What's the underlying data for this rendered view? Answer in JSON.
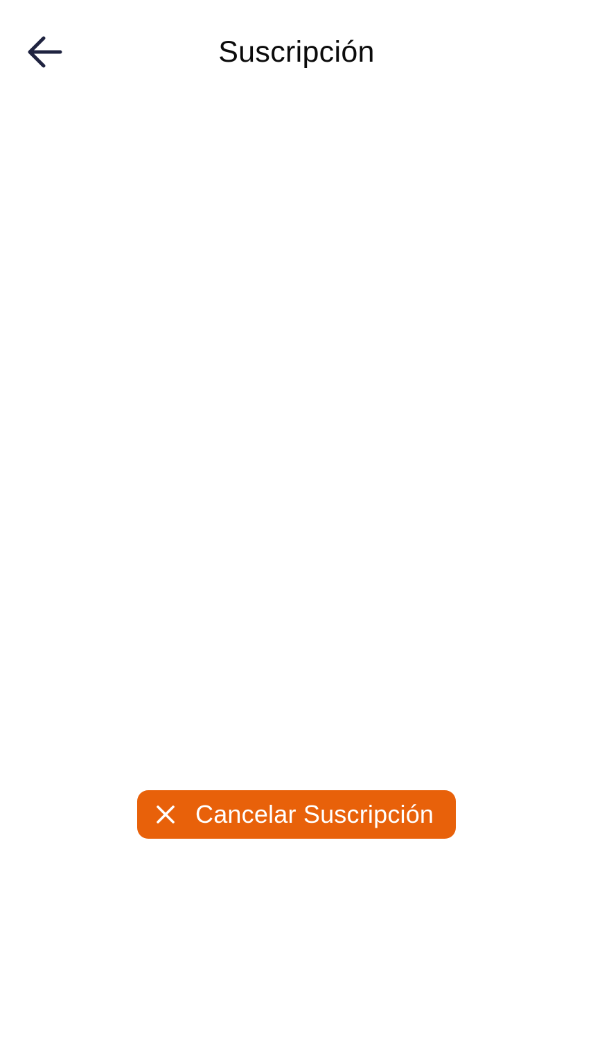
{
  "header": {
    "title": "Suscripción",
    "back_icon": "arrow-left-icon"
  },
  "actions": {
    "cancel_label": "Cancelar Suscripción",
    "cancel_icon": "close-icon"
  },
  "colors": {
    "accent": "#E8610A",
    "icon_dark": "#1F2340",
    "background": "#FFFFFF"
  }
}
